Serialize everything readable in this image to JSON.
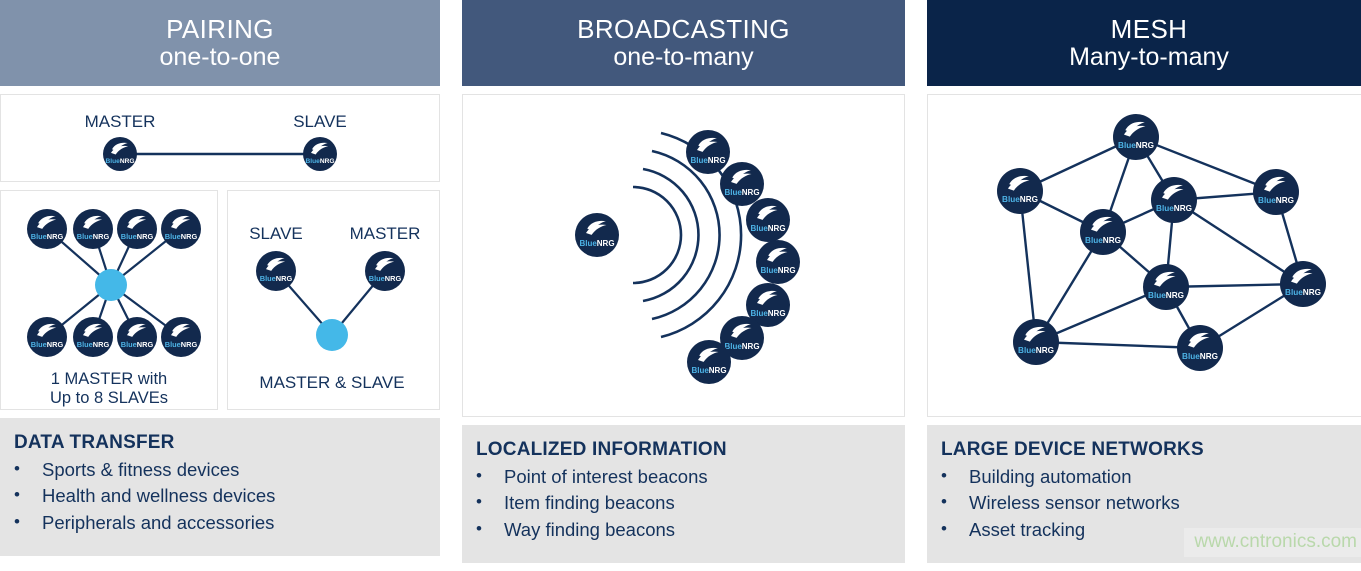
{
  "columns": [
    {
      "id": "pairing",
      "header": {
        "title": "PAIRING",
        "subtitle": "one-to-one",
        "color": "#8092ab"
      },
      "diagrams": {
        "top": {
          "labels": [
            "MASTER",
            "SLAVE"
          ]
        },
        "left": {
          "caption_line1": "1 MASTER with",
          "caption_line2": "Up to 8 SLAVEs",
          "node_count": 8,
          "hub_color": "#44b8e8"
        },
        "right": {
          "labels": [
            "SLAVE",
            "MASTER"
          ],
          "caption": "MASTER & SLAVE",
          "node_count": 2,
          "hub_color": "#44b8e8"
        }
      },
      "info": {
        "title": "DATA TRANSFER",
        "bullet": "•",
        "items": [
          "Sports & fitness devices",
          "Health and wellness devices",
          "Peripherals and accessories"
        ]
      }
    },
    {
      "id": "broadcasting",
      "header": {
        "title": "BROADCASTING",
        "subtitle": "one-to-many",
        "color": "#42587c"
      },
      "diagrams": {
        "broadcaster_count": 1,
        "receiver_count": 7,
        "wave_arcs": 4
      },
      "info": {
        "title": "LOCALIZED INFORMATION",
        "bullet": "•",
        "items": [
          "Point of interest beacons",
          "Item finding beacons",
          "Way finding beacons"
        ]
      }
    },
    {
      "id": "mesh",
      "header": {
        "title": "MESH",
        "subtitle": "Many-to-many",
        "color": "#0a2449"
      },
      "diagrams": {
        "node_count": 9,
        "edge_count": 18
      },
      "info": {
        "title": "LARGE DEVICE NETWORKS",
        "bullet": "•",
        "items": [
          "Building automation",
          "Wireless sensor networks",
          "Asset tracking"
        ]
      }
    }
  ],
  "node_logo": {
    "brand_light": "Blue",
    "brand_bold": "NRG",
    "icon": "bluenrg-wing-icon"
  },
  "watermark": {
    "text": "www.cntronics.com",
    "color": "#b9d8ab"
  },
  "palette": {
    "node_navy": "#12294d",
    "hub_blue": "#44b8e8",
    "text_navy": "#14325c",
    "info_bg": "#e4e4e4",
    "panel_border": "#e3e3e3"
  }
}
